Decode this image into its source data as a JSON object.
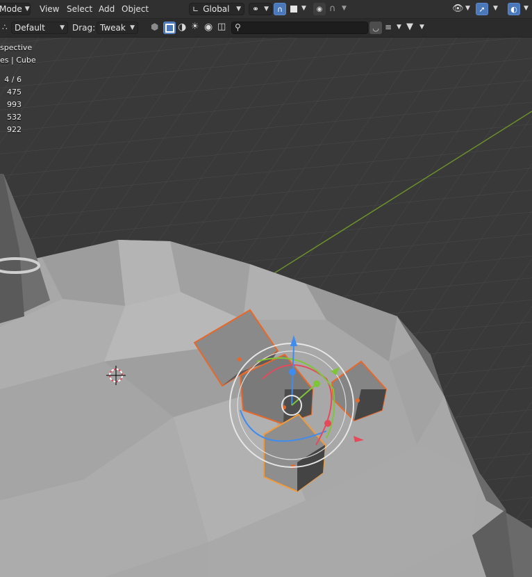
{
  "header": {
    "mode_label": "Mode",
    "menus": [
      "View",
      "Select",
      "Add",
      "Object"
    ],
    "orientation_label": "Global"
  },
  "tool_header": {
    "pivot_label": "Default",
    "drag_label": "Drag:",
    "drag_value": "Tweak",
    "search_placeholder": ""
  },
  "overlay": {
    "view_name": "spective",
    "collection_label": "es | Cube",
    "stats": [
      "4 / 6",
      "475",
      "993",
      "532",
      "922"
    ]
  },
  "colors": {
    "accent_blue": "#4a78b8",
    "selection_outline": "#e8682a",
    "active_outline": "#f29a3a",
    "axis_x": "#e44a5a",
    "axis_y": "#7fc53a",
    "axis_z": "#3f8cf0"
  }
}
